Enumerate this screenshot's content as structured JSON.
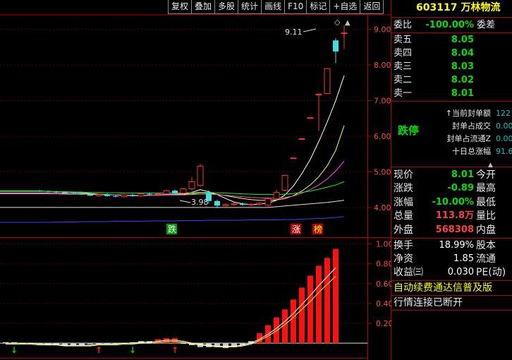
{
  "toolbar": {
    "items": [
      "复权",
      "叠加",
      "多股",
      "统计",
      "画线",
      "F10",
      "标记",
      "+自选",
      "返回"
    ]
  },
  "stock": {
    "code": "603117",
    "name": "万林物流"
  },
  "order_ratio": {
    "label": "委比",
    "value": "-100.00%",
    "label2": "委差"
  },
  "asks": [
    {
      "label": "卖五",
      "price": "8.05"
    },
    {
      "label": "卖四",
      "price": "8.04"
    },
    {
      "label": "卖三",
      "price": "8.03"
    },
    {
      "label": "卖二",
      "price": "8.02"
    },
    {
      "label": "卖一",
      "price": "8.01"
    }
  ],
  "limit_status": "跌停",
  "limit_info": [
    {
      "label": "当前封单额",
      "value": "122",
      "prefix": "↑"
    },
    {
      "label": "封单占成交",
      "value": "0.00"
    },
    {
      "label": "封单占流通Z",
      "value": "0.00"
    },
    {
      "label": "十日总涨幅",
      "value": "91.6"
    }
  ],
  "quotes": [
    {
      "label": "现价",
      "value": "8.01",
      "label2": "今开"
    },
    {
      "label": "涨跌",
      "value": "-0.89",
      "label2": "最高"
    },
    {
      "label": "涨幅",
      "value": "-10.00%",
      "label2": "最低"
    },
    {
      "label": "总量",
      "value": "113.8万",
      "label2": "量比"
    },
    {
      "label": "外盘",
      "value": "568308",
      "label2": "内盘"
    },
    {
      "label": "换手",
      "value": "18.99%",
      "label2": "股本"
    },
    {
      "label": "净资",
      "value": "1.85",
      "label2": "流通"
    },
    {
      "label": "收益㈢",
      "value": "0.030",
      "label2": "PE(动)"
    }
  ],
  "notices": {
    "promo": "自动续费通达信普及版",
    "status": "行情连接已断开"
  },
  "price_axis": [
    "9.00",
    "8.00",
    "7.00",
    "6.00",
    "5.00",
    "4.00"
  ],
  "indicator_axis": [
    "1.00",
    "0.80",
    "0.60",
    "0.40",
    "0.20"
  ],
  "chart_labels": {
    "high_marker": "9.11",
    "low_marker": "3.98",
    "tag_die": "跌",
    "tag_zhang": "涨",
    "tag_bang": "榜"
  },
  "chart_data": {
    "type": "candlestick",
    "ylim": [
      3.6,
      9.35
    ],
    "candles": [
      {
        "o": 4.47,
        "h": 4.49,
        "l": 4.44,
        "c": 4.46
      },
      {
        "o": 4.46,
        "h": 4.48,
        "l": 4.42,
        "c": 4.44
      },
      {
        "o": 4.44,
        "h": 4.47,
        "l": 4.4,
        "c": 4.42
      },
      {
        "o": 4.42,
        "h": 4.45,
        "l": 4.38,
        "c": 4.4
      },
      {
        "o": 4.4,
        "h": 4.44,
        "l": 4.36,
        "c": 4.38
      },
      {
        "o": 4.38,
        "h": 4.42,
        "l": 4.35,
        "c": 4.36
      },
      {
        "o": 4.36,
        "h": 4.4,
        "l": 4.32,
        "c": 4.33
      },
      {
        "o": 4.33,
        "h": 4.38,
        "l": 4.3,
        "c": 4.36
      },
      {
        "o": 4.36,
        "h": 4.4,
        "l": 4.3,
        "c": 4.32
      },
      {
        "o": 4.32,
        "h": 4.36,
        "l": 4.28,
        "c": 4.3
      },
      {
        "o": 4.3,
        "h": 4.36,
        "l": 4.28,
        "c": 4.35
      },
      {
        "o": 4.35,
        "h": 4.38,
        "l": 4.3,
        "c": 4.32
      },
      {
        "o": 4.32,
        "h": 4.4,
        "l": 4.3,
        "c": 4.38
      },
      {
        "o": 4.38,
        "h": 4.42,
        "l": 4.34,
        "c": 4.36
      },
      {
        "o": 4.36,
        "h": 4.4,
        "l": 4.32,
        "c": 4.38
      },
      {
        "o": 4.38,
        "h": 4.5,
        "l": 4.36,
        "c": 4.47
      },
      {
        "o": 4.47,
        "h": 4.5,
        "l": 4.36,
        "c": 4.4
      },
      {
        "o": 4.4,
        "h": 4.55,
        "l": 4.38,
        "c": 4.52
      },
      {
        "o": 4.52,
        "h": 4.85,
        "l": 4.48,
        "c": 4.72
      },
      {
        "o": 4.62,
        "h": 5.22,
        "l": 4.58,
        "c": 5.16
      },
      {
        "o": 4.42,
        "h": 4.48,
        "l": 4.1,
        "c": 4.18
      },
      {
        "o": 4.18,
        "h": 4.22,
        "l": 3.98,
        "c": 4.05
      },
      {
        "o": 4.05,
        "h": 4.12,
        "l": 3.98,
        "c": 4.08
      },
      {
        "o": 4.08,
        "h": 4.14,
        "l": 4.04,
        "c": 4.1
      },
      {
        "o": 4.1,
        "h": 4.14,
        "l": 4.05,
        "c": 4.07
      },
      {
        "o": 4.07,
        "h": 4.12,
        "l": 4.03,
        "c": 4.09
      },
      {
        "o": 4.09,
        "h": 4.15,
        "l": 4.04,
        "c": 4.12
      },
      {
        "o": 4.06,
        "h": 4.3,
        "l": 4.02,
        "c": 4.24
      },
      {
        "o": 4.24,
        "h": 4.5,
        "l": 4.2,
        "c": 4.42
      },
      {
        "o": 4.48,
        "h": 4.92,
        "l": 4.45,
        "c": 4.9
      },
      {
        "o": 5.39,
        "h": 5.39,
        "l": 5.39,
        "c": 5.39
      },
      {
        "o": 5.93,
        "h": 5.93,
        "l": 5.93,
        "c": 5.93
      },
      {
        "o": 6.52,
        "h": 6.52,
        "l": 6.52,
        "c": 6.52
      },
      {
        "o": 7.18,
        "h": 7.2,
        "l": 6.15,
        "c": 7.18
      },
      {
        "o": 7.2,
        "h": 7.92,
        "l": 7.18,
        "c": 7.9
      },
      {
        "o": 8.69,
        "h": 8.75,
        "l": 8.05,
        "c": 8.38
      },
      {
        "o": 8.9,
        "h": 9.11,
        "l": 8.45,
        "c": 8.9
      }
    ],
    "ma_lines": [
      {
        "color": "#ffffff",
        "values": [
          4.46,
          4.45,
          4.44,
          4.43,
          4.42,
          4.41,
          4.39,
          4.37,
          4.36,
          4.35,
          4.34,
          4.33,
          4.33,
          4.34,
          4.35,
          4.36,
          4.37,
          4.38,
          4.42,
          4.5,
          4.44,
          4.36,
          4.25,
          4.15,
          4.1,
          4.08,
          4.09,
          4.12,
          4.2,
          4.35,
          4.6,
          4.95,
          5.35,
          5.85,
          6.4,
          7.0,
          7.7
        ]
      },
      {
        "color": "#ffff40",
        "values": [
          4.4,
          4.4,
          4.39,
          4.39,
          4.38,
          4.38,
          4.37,
          4.36,
          4.35,
          4.35,
          4.34,
          4.34,
          4.34,
          4.34,
          4.35,
          4.35,
          4.36,
          4.37,
          4.38,
          4.41,
          4.4,
          4.37,
          4.33,
          4.29,
          4.25,
          4.22,
          4.2,
          4.2,
          4.21,
          4.25,
          4.33,
          4.46,
          4.63,
          4.86,
          5.17,
          5.6,
          6.3
        ]
      },
      {
        "color": "#ff40ff",
        "values": [
          4.38,
          4.38,
          4.38,
          4.37,
          4.37,
          4.37,
          4.36,
          4.36,
          4.35,
          4.35,
          4.35,
          4.34,
          4.34,
          4.34,
          4.34,
          4.35,
          4.35,
          4.35,
          4.36,
          4.37,
          4.37,
          4.36,
          4.34,
          4.32,
          4.3,
          4.28,
          4.27,
          4.26,
          4.26,
          4.28,
          4.32,
          4.4,
          4.5,
          4.63,
          4.8,
          5.02,
          5.3
        ]
      },
      {
        "color": "#00ff00",
        "values": [
          4.45,
          4.45,
          4.44,
          4.44,
          4.43,
          4.43,
          4.42,
          4.42,
          4.41,
          4.41,
          4.4,
          4.4,
          4.4,
          4.4,
          4.4,
          4.4,
          4.4,
          4.41,
          4.41,
          4.42,
          4.42,
          4.41,
          4.4,
          4.39,
          4.38,
          4.37,
          4.36,
          4.36,
          4.36,
          4.37,
          4.39,
          4.42,
          4.46,
          4.51,
          4.57,
          4.63,
          4.72
        ]
      },
      {
        "color": "#e0e0e0",
        "values": [
          4.0,
          4.0,
          4.0,
          4.0,
          4.0,
          4.0,
          4.0,
          4.0,
          4.0,
          4.0,
          4.0,
          4.0,
          4.0,
          4.0,
          4.0,
          4.0,
          4.0,
          4.0,
          4.0,
          4.0,
          4.0,
          4.0,
          4.0,
          4.0,
          4.0,
          4.0,
          4.0,
          4.0,
          4.02,
          4.04,
          4.06,
          4.08,
          4.1,
          4.12,
          4.14,
          4.17,
          4.2
        ]
      },
      {
        "color": "#4040ff",
        "values": [
          3.58,
          3.58,
          3.59,
          3.59,
          3.59,
          3.6,
          3.6,
          3.6,
          3.6,
          3.61,
          3.61,
          3.61,
          3.61,
          3.62,
          3.62,
          3.62,
          3.62,
          3.63,
          3.63,
          3.63,
          3.64,
          3.64,
          3.64,
          3.64,
          3.64,
          3.65,
          3.65,
          3.65,
          3.65,
          3.66,
          3.66,
          3.67,
          3.68,
          3.69,
          3.7,
          3.72,
          3.74
        ]
      }
    ],
    "indicator": {
      "ylim": [
        -0.12,
        1.04
      ],
      "bars": [
        0.01,
        0.01,
        0.0,
        -0.01,
        -0.01,
        -0.02,
        -0.02,
        -0.03,
        -0.02,
        -0.02,
        -0.01,
        -0.01,
        -0.01,
        0.0,
        0.0,
        0.01,
        0.02,
        0.02,
        0.04,
        0.05,
        0.05,
        0.0,
        -0.02,
        -0.04,
        -0.04,
        -0.04,
        -0.05,
        -0.04,
        -0.02,
        0.02,
        0.1,
        0.18,
        0.26,
        0.34,
        0.44,
        0.56,
        0.68,
        0.78,
        0.86,
        0.95
      ],
      "line": [
        0.0,
        0.0,
        0.0,
        0.0,
        -0.01,
        -0.01,
        -0.01,
        -0.02,
        -0.02,
        -0.02,
        -0.02,
        -0.01,
        -0.01,
        -0.01,
        0.0,
        0.0,
        0.01,
        0.01,
        0.02,
        0.03,
        0.03,
        0.02,
        0.0,
        -0.01,
        -0.02,
        -0.03,
        -0.03,
        -0.03,
        -0.02,
        0.0,
        0.04,
        0.09,
        0.15,
        0.22,
        0.3,
        0.39,
        0.48,
        0.58,
        0.67,
        0.76
      ],
      "down_arrows": [
        1,
        15
      ],
      "up_arrows": [
        11,
        20
      ]
    }
  }
}
